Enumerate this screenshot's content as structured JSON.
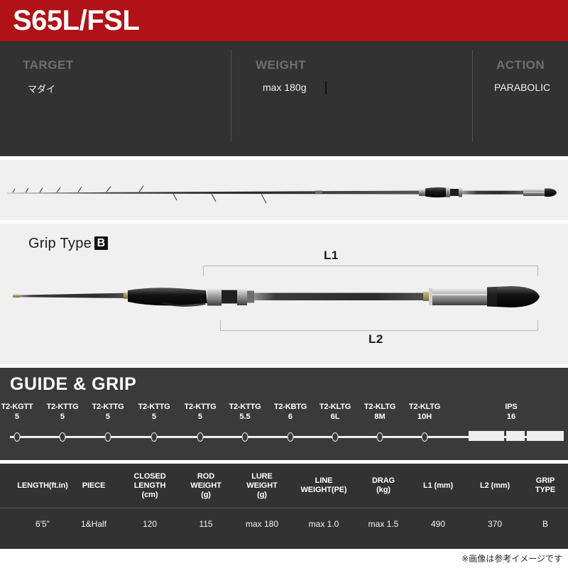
{
  "header": {
    "model": "S65L/FSL",
    "accent_color": "#b01217"
  },
  "specs": {
    "columns": [
      {
        "label": "TARGET",
        "value": "マダイ"
      },
      {
        "label": "WEIGHT",
        "value": "max 180g"
      },
      {
        "label": "ACTION",
        "value": "PARABOLIC"
      }
    ]
  },
  "grip_panel": {
    "grip_type_text": "Grip Type",
    "grip_type_badge": "B",
    "dim_l1": "L1",
    "dim_l2": "L2"
  },
  "guide_section": {
    "title": "GUIDE & GRIP",
    "guides": [
      {
        "name": "T2-KGTT",
        "size": "5"
      },
      {
        "name": "T2-KTTG",
        "size": "5"
      },
      {
        "name": "T2-KTTG",
        "size": "5"
      },
      {
        "name": "T2-KTTG",
        "size": "5"
      },
      {
        "name": "T2-KTTG",
        "size": "5"
      },
      {
        "name": "T2-KTTG",
        "size": "5.5"
      },
      {
        "name": "T2-KBTG",
        "size": "6"
      },
      {
        "name": "T2-KLTG",
        "size": "6L"
      },
      {
        "name": "T2-KLTG",
        "size": "8M"
      },
      {
        "name": "T2-KLTG",
        "size": "10H"
      }
    ],
    "reel_seat": {
      "name": "IPS",
      "size": "16"
    }
  },
  "spec_table": {
    "headers": [
      "LENGTH(ft.in)",
      "PIECE",
      "CLOSED\nLENGTH\n(cm)",
      "ROD\nWEIGHT\n(g)",
      "LURE\nWEIGHT\n(g)",
      "LINE\nWEIGHT(PE)",
      "DRAG\n(kg)",
      "L1 (mm)",
      "L2 (mm)",
      "GRIP\nTYPE"
    ],
    "row": [
      "6'5\"",
      "1&Half",
      "120",
      "115",
      "max 180",
      "max 1.0",
      "max 1.5",
      "490",
      "370",
      "B"
    ]
  },
  "footnote": "※画像は参考イメージです"
}
